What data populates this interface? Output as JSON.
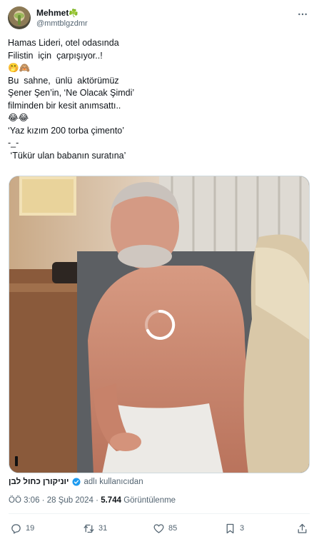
{
  "header": {
    "display_name": "Mehmet",
    "name_emoji": "☘️",
    "handle": "@mmtblgzdmr",
    "more_icon": "more-horizontal-icon"
  },
  "tweet": {
    "lines": [
      "Hamas Lideri, otel odasında",
      "Filistin  için  çarpışıyor..!",
      "🤭🙈",
      "Bu  sahne,  ünlü  aktörümüz",
      "Şener Şen’in, ‘Ne Olacak Şimdi’",
      "filminden bir kesit anımsattı..",
      "😂😂",
      "‘Yaz kızım 200 torba çimento’",
      "-_-",
      " ‘Tükür ulan babanın suratına’"
    ]
  },
  "media": {
    "type": "video",
    "state": "loading",
    "spinner_icon": "loading-spinner-icon",
    "pause_icon": "pause-icon"
  },
  "source": {
    "name": "יוניקורן כחול לבן",
    "verified_icon": "verified-badge-icon",
    "used_label": "adlı kullanıcıdan",
    "verified_color": "#1d9bf0"
  },
  "meta": {
    "time": "ÖÖ 3:06",
    "separator": "·",
    "date": "28 Şub 2024",
    "views": "5.744",
    "views_label": "Görüntülenme"
  },
  "actions": {
    "reply_count": "19",
    "retweet_count": "31",
    "like_count": "85",
    "bookmark_count": "3"
  }
}
